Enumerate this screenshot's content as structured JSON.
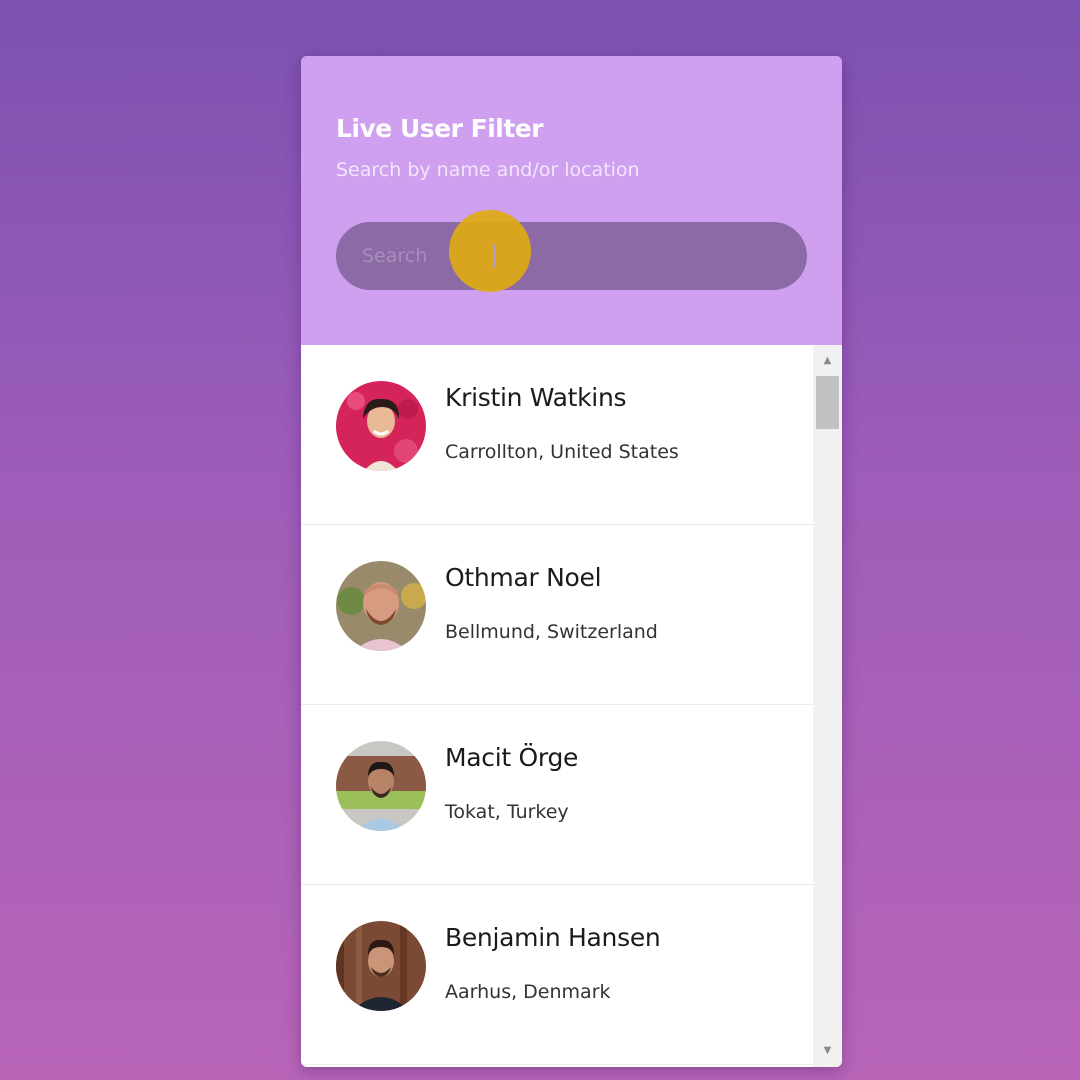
{
  "header": {
    "title": "Live User Filter",
    "subtitle": "Search by name and/or location"
  },
  "search": {
    "placeholder": "Search",
    "value": ""
  },
  "users": [
    {
      "name": "Kristin Watkins",
      "location": "Carrollton, United States"
    },
    {
      "name": "Othmar Noel",
      "location": "Bellmund, Switzerland"
    },
    {
      "name": "Macit Örge",
      "location": "Tokat, Turkey"
    },
    {
      "name": "Benjamin Hansen",
      "location": "Aarhus, Denmark"
    }
  ],
  "scrollbar": {
    "up_icon": "▲",
    "down_icon": "▼"
  },
  "colors": {
    "background_top": "#7c51b1",
    "background_bottom": "#b865b8",
    "header": "#cf9ff0",
    "search_field": "#8c6aa5",
    "cursor_highlight": "#deaa12"
  }
}
